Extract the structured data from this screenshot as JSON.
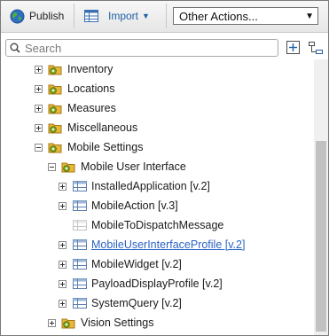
{
  "toolbar": {
    "publish_label": "Publish",
    "import_label": "Import",
    "actions_value": "Other Actions..."
  },
  "search": {
    "placeholder": "Search"
  },
  "tree": {
    "items": [
      {
        "label": "Inventory",
        "state": "collapsed",
        "icon": "folder-gear-icon",
        "link": false
      },
      {
        "label": "Locations",
        "state": "collapsed",
        "icon": "folder-gear-icon",
        "link": false
      },
      {
        "label": "Measures",
        "state": "collapsed",
        "icon": "folder-gear-icon",
        "link": false
      },
      {
        "label": "Miscellaneous",
        "state": "collapsed",
        "icon": "folder-gear-icon",
        "link": false
      },
      {
        "label": "Mobile Settings",
        "state": "expanded",
        "icon": "folder-gear-icon",
        "link": false
      },
      {
        "label": "Mobile User Interface",
        "state": "expanded",
        "icon": "folder-gear-icon",
        "link": false
      },
      {
        "label": "InstalledApplication [v.2]",
        "state": "collapsed",
        "icon": "table-icon",
        "link": false
      },
      {
        "label": "MobileAction [v.3]",
        "state": "collapsed",
        "icon": "table-icon",
        "link": false
      },
      {
        "label": "MobileToDispatchMessage",
        "state": "leaf",
        "icon": "table-icon",
        "link": false
      },
      {
        "label": "MobileUserInterfaceProfile [v.2]",
        "state": "collapsed",
        "icon": "table-icon",
        "link": true
      },
      {
        "label": "MobileWidget [v.2]",
        "state": "collapsed",
        "icon": "table-icon",
        "link": false
      },
      {
        "label": "PayloadDisplayProfile [v.2]",
        "state": "collapsed",
        "icon": "table-icon",
        "link": false
      },
      {
        "label": "SystemQuery [v.2]",
        "state": "collapsed",
        "icon": "table-icon",
        "link": false
      },
      {
        "label": "Vision Settings",
        "state": "collapsed",
        "icon": "folder-gear-icon",
        "link": false
      }
    ]
  },
  "colors": {
    "link": "#2a63c4",
    "import": "#1f5fa8",
    "scroll_thumb": "#c1c1c1"
  }
}
